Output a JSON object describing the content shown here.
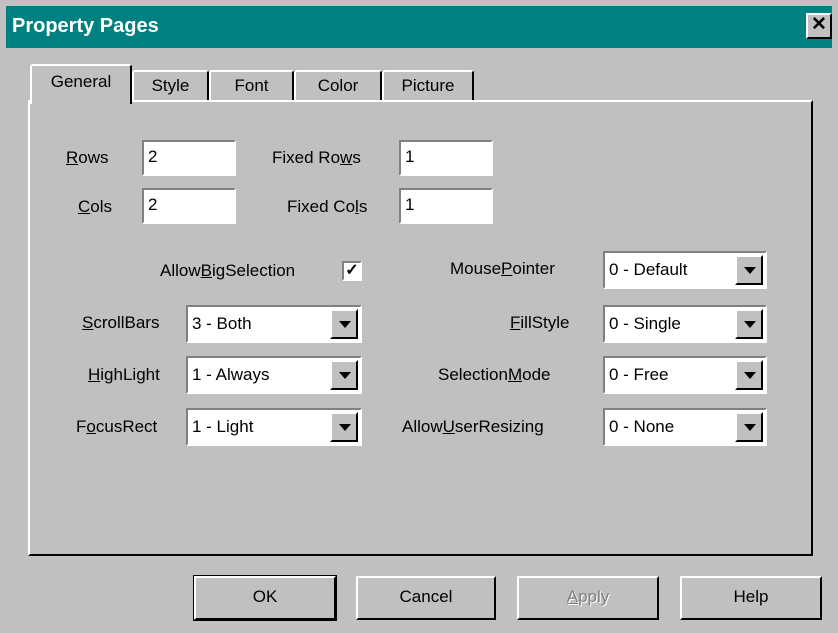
{
  "window": {
    "title": "Property Pages",
    "close_glyph": "✕"
  },
  "tabs": [
    {
      "label": "General",
      "active": true
    },
    {
      "label": "Style",
      "active": false
    },
    {
      "label": "Font",
      "active": false
    },
    {
      "label": "Color",
      "active": false
    },
    {
      "label": "Picture",
      "active": false
    }
  ],
  "fields": {
    "rows": {
      "label_accel": "R",
      "label_rest": "ows",
      "value": "2"
    },
    "cols": {
      "label_accel": "C",
      "label_rest": "ols",
      "value": "2"
    },
    "fixed_rows": {
      "label_pre": "Fixed Ro",
      "label_accel": "w",
      "label_post": "s",
      "value": "1"
    },
    "fixed_cols": {
      "label_pre": "Fixed Co",
      "label_accel": "l",
      "label_post": "s",
      "value": "1"
    },
    "allow_big_selection": {
      "label_pre": "Allow",
      "label_accel": "B",
      "label_post": "igSelection",
      "checked": true,
      "check_glyph": "✓"
    },
    "scrollbars": {
      "label_accel": "S",
      "label_rest": "crollBars",
      "value": "3 - Both"
    },
    "highlight": {
      "label_accel": "H",
      "label_rest": "ighLight",
      "value": "1 - Always"
    },
    "focusrect": {
      "label_pre": "F",
      "label_accel": "o",
      "label_post": "cusRect",
      "value": "1 - Light"
    },
    "mousepointer": {
      "label_pre": "Mouse",
      "label_accel": "P",
      "label_post": "ointer",
      "value": "0 - Default"
    },
    "fillstyle": {
      "label_accel": "F",
      "label_rest": "illStyle",
      "value": "0 - Single"
    },
    "selectionmode": {
      "label_pre": "Selection",
      "label_accel": "M",
      "label_post": "ode",
      "value": "0 - Free"
    },
    "allowuserresizing": {
      "label_pre": "Allow",
      "label_accel": "U",
      "label_post": "serResizing",
      "value": "0 - None"
    }
  },
  "buttons": {
    "ok": "OK",
    "cancel": "Cancel",
    "apply_accel": "A",
    "apply_rest": "pply",
    "help": "Help"
  },
  "colors": {
    "titlebar": "#008080",
    "face": "#c0c0c0"
  }
}
